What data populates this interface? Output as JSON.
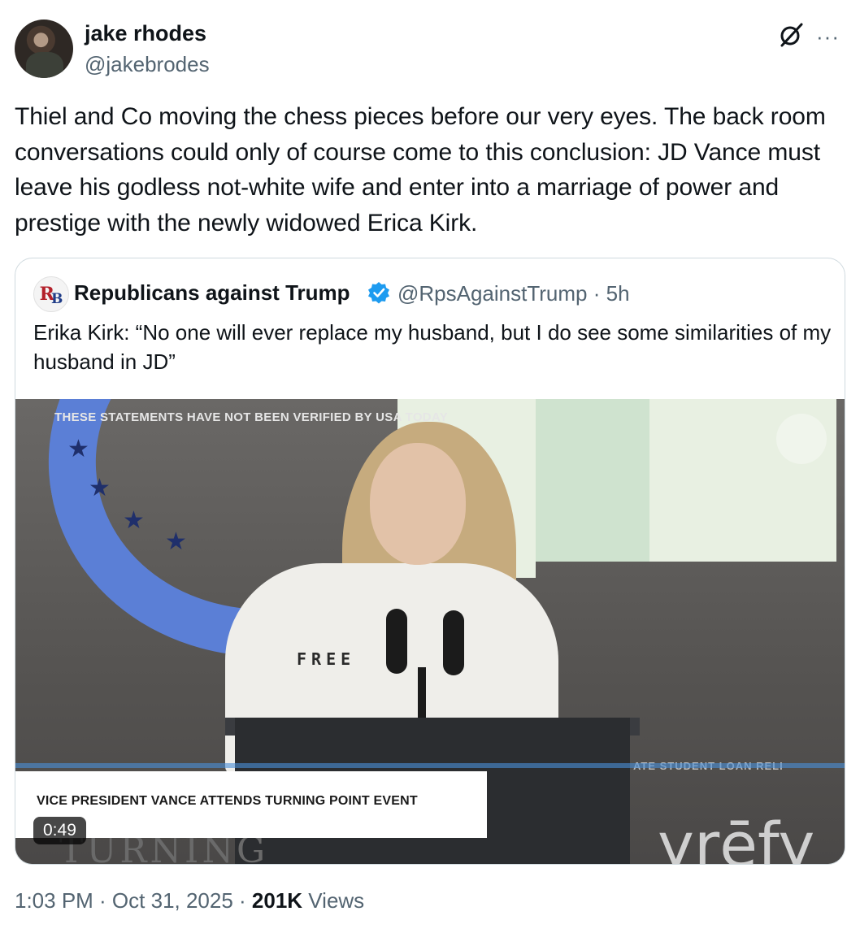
{
  "post": {
    "author_name": "jake rhodes",
    "author_handle": "@jakebrodes",
    "text": "Thiel and Co moving the chess pieces before our very eyes. The back room conversations could only of course come to this conclusion: JD Vance must leave his godless not-white wife and enter into a marriage of power and prestige with the newly widowed Erica Kirk.",
    "more_label": "···",
    "timestamp": "1:03 PM · Oct 31, 2025 · ",
    "views_count": "201K",
    "views_label": " Views"
  },
  "quote": {
    "author_name": "Republicans against Trump",
    "author_handle": "@RpsAgainstTrump · 5h",
    "text": "Erika Kirk: “No one will ever replace my husband, but I do see some similarities of my husband in JD”",
    "verified": true,
    "video": {
      "watermark": "THESE STATEMENTS HAVE NOT BEEN VERIFIED BY USA TODAY",
      "shirt_text": "FREE",
      "caption": "VICE PRESIDENT VANCE ATTENDS TURNING POINT EVENT",
      "sponsor": "yrēfy",
      "sponsor_line": "ATE STUDENT LOAN RELI",
      "background_word": "TURNING",
      "duration": "0:49"
    }
  },
  "colors": {
    "text_primary": "#0f1419",
    "text_secondary": "#536471",
    "verified_blue": "#1d9bf0",
    "border": "#cfd9de"
  }
}
